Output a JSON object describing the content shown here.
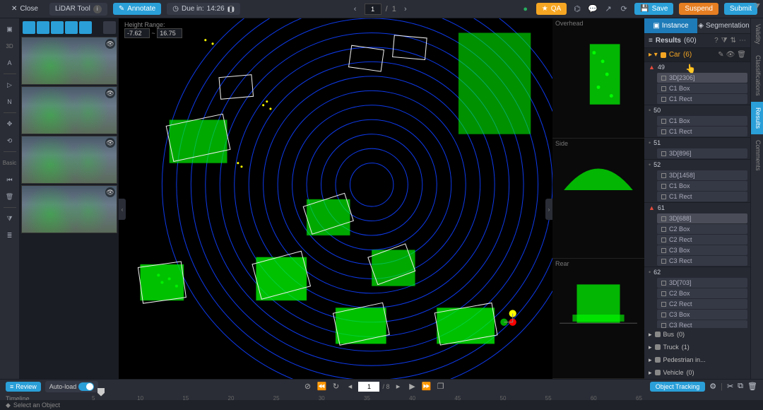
{
  "topbar": {
    "close": "Close",
    "tool": "LiDAR Tool",
    "annotate": "Annotate",
    "due_prefix": "Due in:",
    "due_time": "14:26",
    "page_current": "1",
    "page_total": "1",
    "qa": "QA",
    "save": "Save",
    "suspend": "Suspend",
    "submit": "Submit"
  },
  "lefttool_labels": {
    "td": "3D",
    "basic": "Basic"
  },
  "height_range": {
    "label": "Height Range:",
    "min": "-7.62",
    "max": "16.75"
  },
  "sideviews": {
    "v0": "Overhead",
    "v1": "Side",
    "v2": "Rear"
  },
  "panel": {
    "tab_instance": "Instance",
    "tab_segmentation": "Segmentation",
    "results_label": "Results",
    "results_count": "(60)",
    "class_car": "Car",
    "class_car_count": "(6)"
  },
  "objects": [
    {
      "id": "49",
      "warn": true,
      "items": [
        "3D[2306]",
        "C1 Box",
        "C1 Rect"
      ],
      "sel": 0
    },
    {
      "id": "50",
      "warn": false,
      "items": [
        "C1 Box",
        "C1 Rect"
      ]
    },
    {
      "id": "51",
      "warn": false,
      "items": [
        "3D[896]"
      ]
    },
    {
      "id": "52",
      "warn": false,
      "items": [
        "3D[1458]",
        "C1 Box",
        "C1 Rect"
      ]
    },
    {
      "id": "61",
      "warn": true,
      "items": [
        "3D[688]",
        "C2 Box",
        "C2 Rect",
        "C3 Box",
        "C3 Rect"
      ],
      "sel": 0
    },
    {
      "id": "62",
      "warn": false,
      "items": [
        "3D[703]",
        "C2 Box",
        "C2 Rect",
        "C3 Box",
        "C3 Rect"
      ]
    }
  ],
  "other_classes": [
    {
      "name": "Bus",
      "count": "(0)"
    },
    {
      "name": "Truck",
      "count": "(1)"
    },
    {
      "name": "Pedestrian in...",
      "count": ""
    },
    {
      "name": "Vehicle",
      "count": "(0)"
    }
  ],
  "vtabs": {
    "validity": "Validity",
    "classifications": "Classifications",
    "results": "Results",
    "comments": "Comments"
  },
  "playbar": {
    "review": "Review",
    "autoload": "Auto-load",
    "frame": "1",
    "frames_total": "8",
    "track": "Object Tracking"
  },
  "timeline": {
    "label": "Timeline",
    "ticks": [
      "5",
      "10",
      "15",
      "20",
      "25",
      "30",
      "35",
      "40",
      "45",
      "50",
      "55",
      "60",
      "65"
    ],
    "select": "Select an Object"
  }
}
